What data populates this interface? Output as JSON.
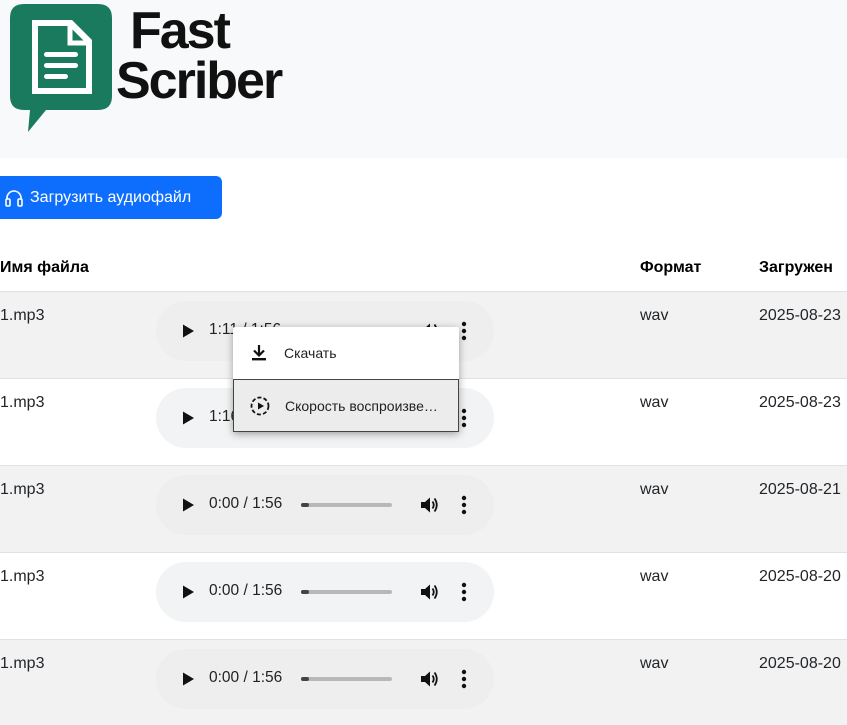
{
  "header": {
    "logo_line1": "Fast",
    "logo_line2": "Scriber",
    "logo_color": "#1a7a5e"
  },
  "upload_button": {
    "label": "Загрузить аудиофайл",
    "icon": "headphones-icon",
    "color": "#0d6efd"
  },
  "table": {
    "columns": [
      "Имя файла",
      "Формат",
      "Загружен"
    ],
    "rows": [
      {
        "filename": "1.mp3",
        "time": "1:11 / 1:56",
        "progress": 0.61,
        "format": "wav",
        "uploaded": "2025-08-23"
      },
      {
        "filename": "1.mp3",
        "time": "1:16 / 1:56",
        "progress": 0.65,
        "format": "wav",
        "uploaded": "2025-08-23"
      },
      {
        "filename": "1.mp3",
        "time": "0:00 / 1:56",
        "progress": 0.0,
        "format": "wav",
        "uploaded": "2025-08-21"
      },
      {
        "filename": "1.mp3",
        "time": "0:00 / 1:56",
        "progress": 0.0,
        "format": "wav",
        "uploaded": "2025-08-20"
      },
      {
        "filename": "1.mp3",
        "time": "0:00 / 1:56",
        "progress": 0.0,
        "format": "wav",
        "uploaded": "2025-08-20"
      }
    ]
  },
  "context_menu": {
    "items": [
      {
        "label": "Скачать",
        "icon": "download-icon"
      },
      {
        "label": "Скорость воспроизве…",
        "icon": "playback-speed-icon"
      }
    ]
  }
}
